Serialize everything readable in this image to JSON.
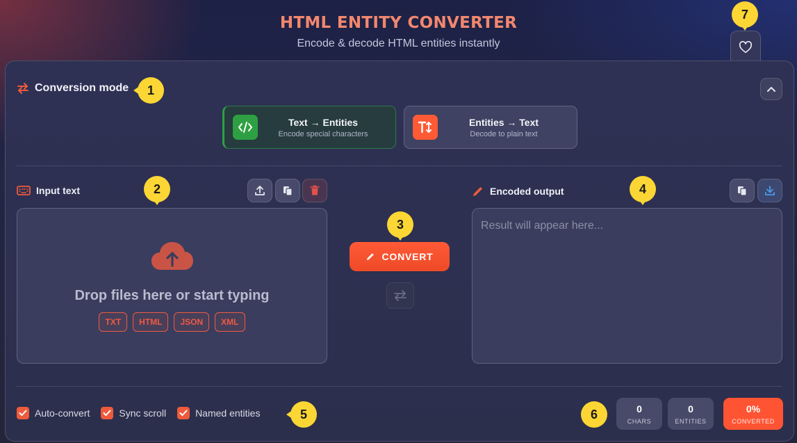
{
  "header": {
    "title": "HTML ENTITY CONVERTER",
    "subtitle": "Encode & decode HTML entities instantly"
  },
  "favorite": {
    "icon": "heart-icon"
  },
  "mode": {
    "title": "Conversion mode",
    "icon": "swap-arrows-icon",
    "collapse_icon": "chevron-up-icon",
    "options": [
      {
        "label": "Text → Entities",
        "desc": "Encode special characters",
        "icon": "code-icon",
        "color": "#2ea043",
        "active": true
      },
      {
        "label": "Entities → Text",
        "desc": "Decode to plain text",
        "icon": "text-cursor-icon",
        "color": "#ff5a36",
        "active": false
      }
    ]
  },
  "input": {
    "title": "Input text",
    "icon": "keyboard-icon",
    "tools": [
      "upload-icon",
      "paste-icon",
      "trash-icon"
    ],
    "drop_text": "Drop files here or start typing",
    "formats": [
      "TXT",
      "HTML",
      "JSON",
      "XML"
    ]
  },
  "convert": {
    "label": "CONVERT",
    "icon": "pencil-icon",
    "swap_icon": "swap-arrows-icon"
  },
  "output": {
    "title": "Encoded output",
    "icon": "pencil-icon",
    "placeholder": "Result will appear here...",
    "value": "",
    "tools": [
      "copy-icon",
      "download-icon"
    ]
  },
  "options": [
    {
      "label": "Auto-convert",
      "checked": true
    },
    {
      "label": "Sync scroll",
      "checked": true
    },
    {
      "label": "Named entities",
      "checked": true
    }
  ],
  "stats": [
    {
      "value": "0",
      "label": "CHARS"
    },
    {
      "value": "0",
      "label": "ENTITIES"
    },
    {
      "value": "0%",
      "label": "CONVERTED"
    }
  ],
  "markers": [
    "1",
    "2",
    "3",
    "4",
    "5",
    "6",
    "7"
  ],
  "colors": {
    "accent": "#ff5a36",
    "success": "#2ea043",
    "marker": "#fcd634",
    "title": "#f3876e"
  }
}
